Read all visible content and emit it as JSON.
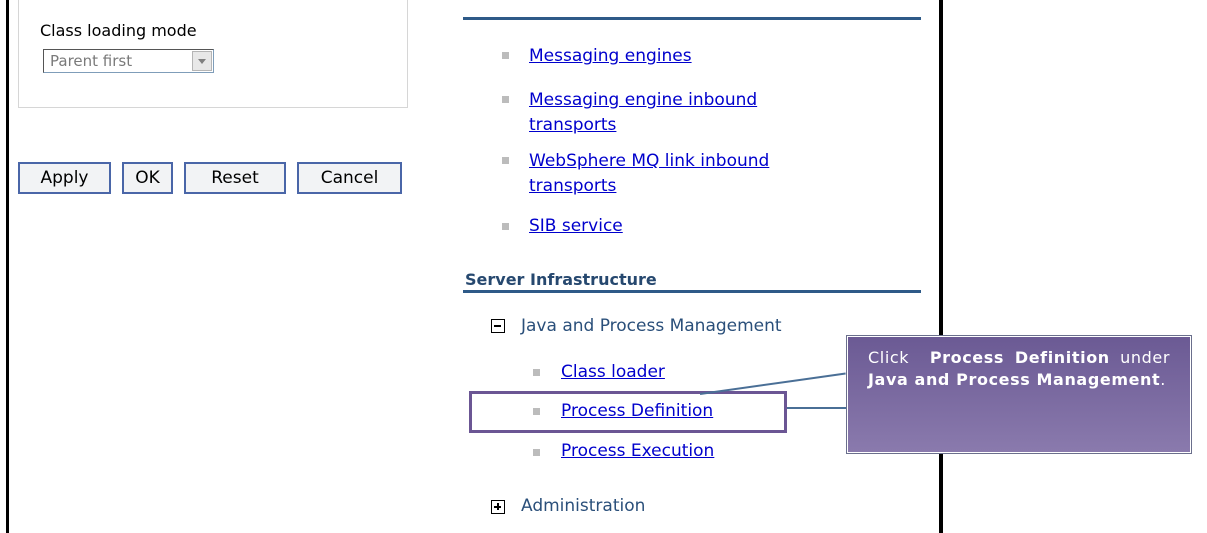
{
  "left_pane": {
    "class_loading_mode_label": "Class loading mode",
    "class_loading_mode_value": "Parent first",
    "buttons": {
      "apply": "Apply",
      "ok": "OK",
      "reset": "Reset",
      "cancel": "Cancel"
    }
  },
  "right_pane": {
    "messaging_links": {
      "engines": "Messaging engines",
      "inbound_1": "Messaging engine inbound",
      "inbound_2": "transports",
      "mq_1": "WebSphere MQ link inbound",
      "mq_2": "transports",
      "sib": "SIB service"
    },
    "server_infrastructure": {
      "title": "Server Infrastructure",
      "java_process_mgmt": "Java and Process Management",
      "class_loader": "Class loader",
      "process_definition": "Process Definition",
      "process_execution": "Process Execution",
      "administration": "Administration"
    }
  },
  "callout": {
    "text_1": "Click",
    "bold_1": "Process Definition",
    "text_2": "under",
    "bold_2": "Java and Process Management",
    "text_3": "."
  },
  "colors": {
    "link": "#0000cc",
    "section_title": "#26486f",
    "callout_bg": "#7a6aa0",
    "button_border": "#4a66a8"
  }
}
